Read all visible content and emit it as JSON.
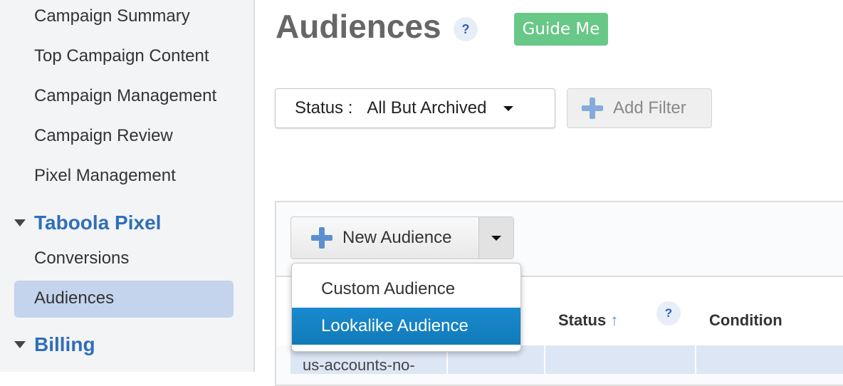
{
  "sidebar": {
    "items": [
      "Campaign Summary",
      "Top Campaign Content",
      "Campaign Management",
      "Campaign Review",
      "Pixel Management"
    ],
    "section_pixel": "Taboola Pixel",
    "pixel_items": [
      "Conversions",
      "Audiences"
    ],
    "section_billing": "Billing"
  },
  "header": {
    "title": "Audiences",
    "help": "?",
    "guide_label": "Guide Me"
  },
  "filters": {
    "status_label": "Status :",
    "status_value": "All But Archived",
    "add_filter": "Add Filter"
  },
  "toolbar": {
    "new_audience": "New Audience"
  },
  "menu": {
    "items": [
      "Custom Audience",
      "Lookalike Audience"
    ],
    "selected": "Lookalike Audience"
  },
  "table": {
    "headers": [
      "Status",
      "Condition"
    ],
    "sort_icon": "↑",
    "help": "?",
    "rows": [
      [
        "us-accounts-no-"
      ]
    ]
  },
  "colors": {
    "accent": "#2f6fb7",
    "guide": "#68c887",
    "selected": "#1889ce"
  }
}
